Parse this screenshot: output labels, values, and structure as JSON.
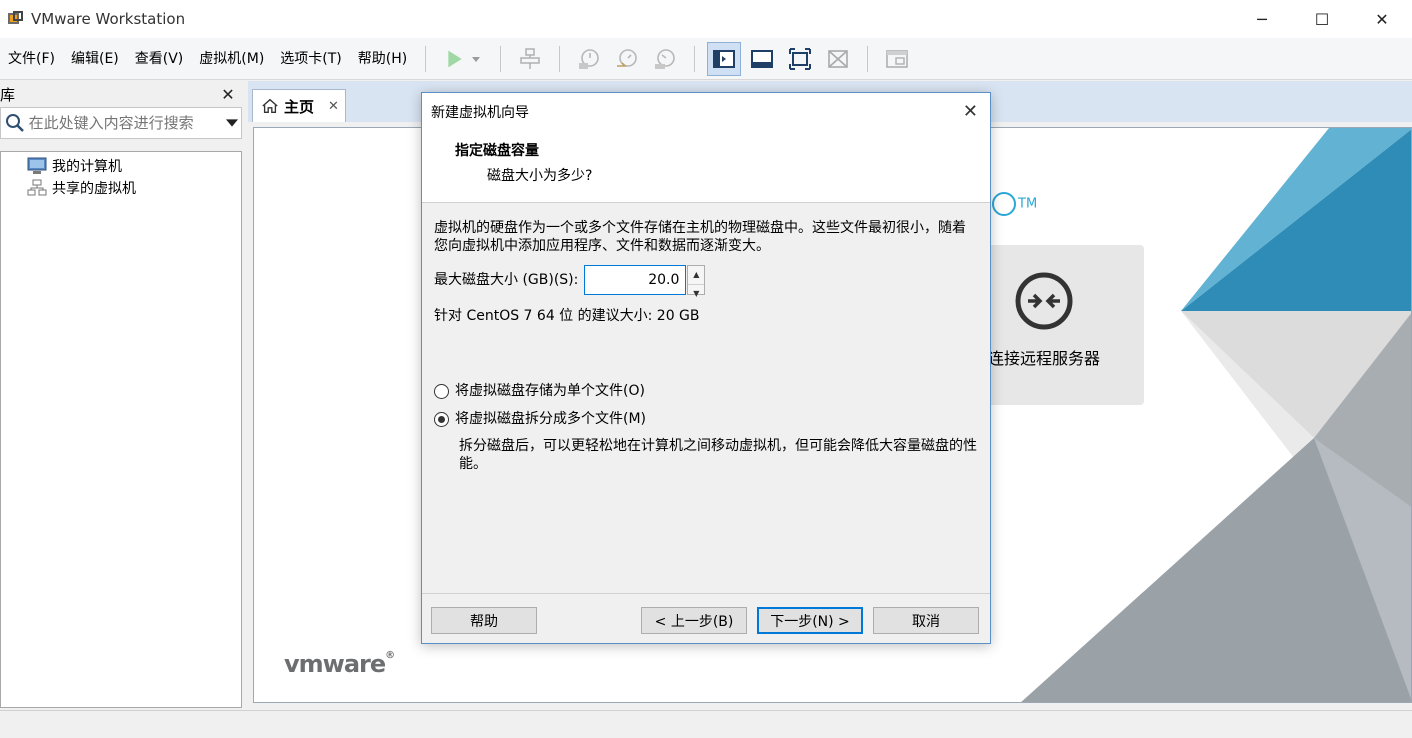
{
  "window": {
    "title": "VMware Workstation"
  },
  "menu": {
    "items": [
      "文件(F)",
      "编辑(E)",
      "查看(V)",
      "虚拟机(M)",
      "选项卡(T)",
      "帮助(H)"
    ]
  },
  "library": {
    "title": "库",
    "search_placeholder": "在此处键入内容进行搜索",
    "tree": [
      "我的计算机",
      "共享的虚拟机"
    ]
  },
  "tabs": {
    "home": "主页"
  },
  "home": {
    "remote_label": "连接远程服务器",
    "tm": "TM",
    "brand": "vmware",
    "brand_mark": "®"
  },
  "dialog": {
    "title": "新建虚拟机向导",
    "heading": "指定磁盘容量",
    "subheading": "磁盘大小为多少?",
    "description": "虚拟机的硬盘作为一个或多个文件存储在主机的物理磁盘中。这些文件最初很小，随着您向虚拟机中添加应用程序、文件和数据而逐渐变大。",
    "max_size_label": "最大磁盘大小 (GB)(S):",
    "max_size_value": "20.0",
    "recommend": "针对 CentOS 7 64 位 的建议大小: 20 GB",
    "option_single": "将虚拟磁盘存储为单个文件(O)",
    "option_split": "将虚拟磁盘拆分成多个文件(M)",
    "selected_option": "split",
    "split_help": "拆分磁盘后，可以更轻松地在计算机之间移动虚拟机，但可能会降低大容量磁盘的性能。",
    "buttons": {
      "help": "帮助",
      "back": "< 上一步(B)",
      "next": "下一步(N) >",
      "cancel": "取消"
    }
  },
  "colors": {
    "accent": "#0078d7",
    "play": "#3cb44b",
    "brand_blue": "#1d8cb8"
  }
}
